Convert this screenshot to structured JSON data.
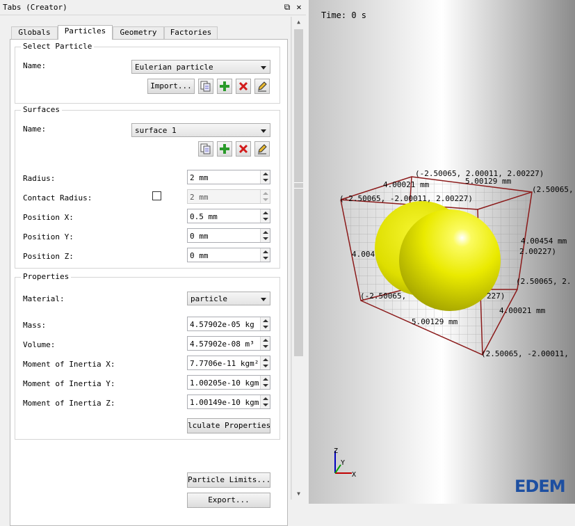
{
  "panel": {
    "title": "Tabs (Creator)",
    "float_icon": "float-icon",
    "close_icon": "close-icon"
  },
  "tabs": [
    {
      "label": "Globals"
    },
    {
      "label": "Particles"
    },
    {
      "label": "Geometry"
    },
    {
      "label": "Factories"
    }
  ],
  "select_particle": {
    "title": "Select Particle",
    "name_label": "Name:",
    "name_value": "Eulerian particle",
    "import_label": "Import..."
  },
  "surfaces": {
    "title": "Surfaces",
    "name_label": "Name:",
    "name_value": "surface 1",
    "radius_label": "Radius:",
    "radius_value": "2 mm",
    "contact_radius_label": "Contact Radius:",
    "contact_radius_value": "2 mm",
    "pos_x_label": "Position X:",
    "pos_x_value": "0.5 mm",
    "pos_y_label": "Position Y:",
    "pos_y_value": "0 mm",
    "pos_z_label": "Position Z:",
    "pos_z_value": "0 mm"
  },
  "properties": {
    "title": "Properties",
    "material_label": "Material:",
    "material_value": "particle",
    "mass_label": "Mass:",
    "mass_value": "4.57902e-05 kg",
    "volume_label": "Volume:",
    "volume_value": "4.57902e-08 m³",
    "moi_x_label": "Moment of Inertia X:",
    "moi_x_value": "7.7706e-11 kgm²",
    "moi_y_label": "Moment of Inertia Y:",
    "moi_y_value": "1.00205e-10 kgm²",
    "moi_z_label": "Moment of Inertia Z:",
    "moi_z_value": "1.00149e-10 kgm²",
    "calc_label": "lculate Properties."
  },
  "footer": {
    "particle_limits_label": "Particle Limits...",
    "export_label": "Export..."
  },
  "viewport": {
    "time": "Time: 0 s",
    "labels": {
      "top_back": "(-2.50065, 2.00011, 2.00227)",
      "top_dim": "4.00021 mm",
      "top_dim2": "5.00129 mm",
      "top_right": "(2.50065,",
      "top_left": "(-2.50065, -2.00011, 2.00227)",
      "right_dim": "4.00454 mm",
      "right_mid": "2.00227)",
      "left_dim": "4.004",
      "right_lower": "(2.50065, 2.",
      "bottom_left": "(-2.50065,",
      "bottom_mid": "227)",
      "bottom_dim": "4.00021 mm",
      "bottom_dim2": "5.00129 mm",
      "bottom_right": "(2.50065, -2.00011,"
    },
    "axis_x": "X",
    "axis_y": "Y",
    "axis_z": "Z",
    "logo": "EDEM",
    "sphere_color": "#f0f000"
  }
}
